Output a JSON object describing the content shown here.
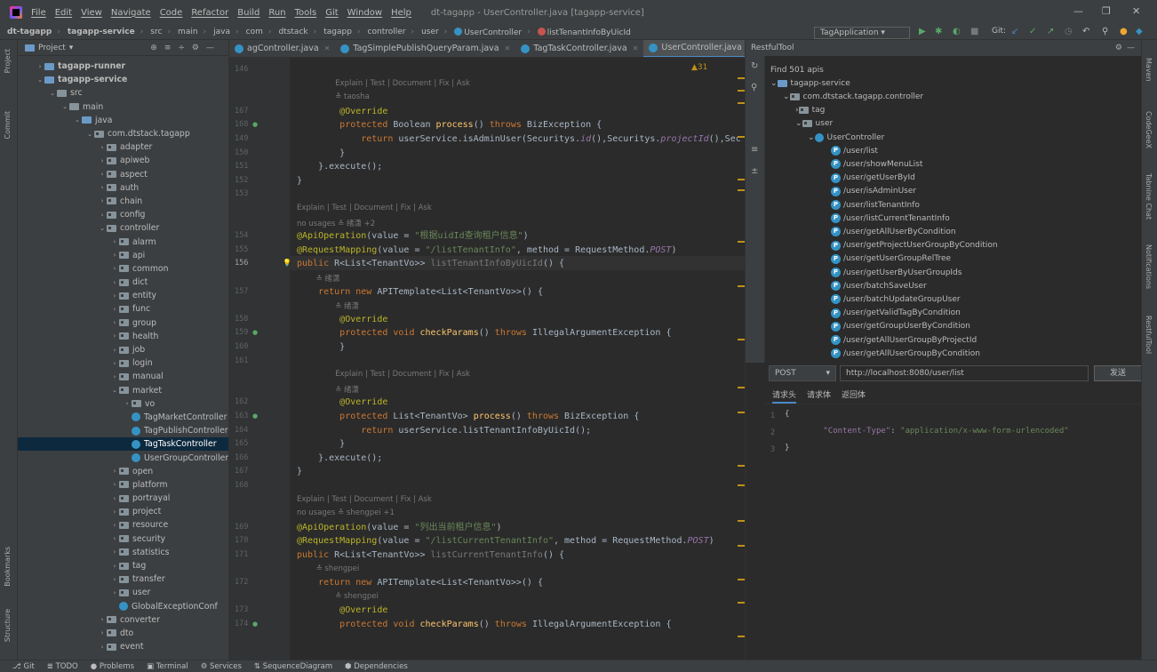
{
  "menu": {
    "items": [
      "File",
      "Edit",
      "View",
      "Navigate",
      "Code",
      "Refactor",
      "Build",
      "Run",
      "Tools",
      "Git",
      "Window",
      "Help"
    ],
    "title": "dt-tagapp - UserController.java [tagapp-service]"
  },
  "nav": {
    "crumbs": [
      "dt-tagapp",
      "tagapp-service",
      "src",
      "main",
      "java",
      "com",
      "dtstack",
      "tagapp",
      "controller",
      "user",
      "UserController",
      "listTenantInfoByUicId"
    ],
    "run_config": "TagApplication",
    "git": "Git:"
  },
  "project": {
    "title": "Project",
    "tree": [
      {
        "label": "tagapp-runner",
        "indent": 1,
        "arrow": "›",
        "icon": "fold blue",
        "bold": true
      },
      {
        "label": "tagapp-service",
        "indent": 1,
        "arrow": "⌄",
        "icon": "fold blue",
        "bold": true
      },
      {
        "label": "src",
        "indent": 2,
        "arrow": "⌄",
        "icon": "fold"
      },
      {
        "label": "main",
        "indent": 3,
        "arrow": "⌄",
        "icon": "fold"
      },
      {
        "label": "java",
        "indent": 4,
        "arrow": "⌄",
        "icon": "fold blue"
      },
      {
        "label": "com.dtstack.tagapp",
        "indent": 5,
        "arrow": "⌄",
        "icon": "fold pkg"
      },
      {
        "label": "adapter",
        "indent": 6,
        "arrow": "›",
        "icon": "fold pkg"
      },
      {
        "label": "apiweb",
        "indent": 6,
        "arrow": "›",
        "icon": "fold pkg"
      },
      {
        "label": "aspect",
        "indent": 6,
        "arrow": "›",
        "icon": "fold pkg"
      },
      {
        "label": "auth",
        "indent": 6,
        "arrow": "›",
        "icon": "fold pkg"
      },
      {
        "label": "chain",
        "indent": 6,
        "arrow": "›",
        "icon": "fold pkg"
      },
      {
        "label": "config",
        "indent": 6,
        "arrow": "›",
        "icon": "fold pkg"
      },
      {
        "label": "controller",
        "indent": 6,
        "arrow": "⌄",
        "icon": "fold pkg"
      },
      {
        "label": "alarm",
        "indent": 7,
        "arrow": "›",
        "icon": "fold pkg"
      },
      {
        "label": "api",
        "indent": 7,
        "arrow": "›",
        "icon": "fold pkg"
      },
      {
        "label": "common",
        "indent": 7,
        "arrow": "›",
        "icon": "fold pkg"
      },
      {
        "label": "dict",
        "indent": 7,
        "arrow": "›",
        "icon": "fold pkg"
      },
      {
        "label": "entity",
        "indent": 7,
        "arrow": "›",
        "icon": "fold pkg"
      },
      {
        "label": "func",
        "indent": 7,
        "arrow": "›",
        "icon": "fold pkg"
      },
      {
        "label": "group",
        "indent": 7,
        "arrow": "›",
        "icon": "fold pkg"
      },
      {
        "label": "health",
        "indent": 7,
        "arrow": "›",
        "icon": "fold pkg"
      },
      {
        "label": "job",
        "indent": 7,
        "arrow": "›",
        "icon": "fold pkg"
      },
      {
        "label": "login",
        "indent": 7,
        "arrow": "›",
        "icon": "fold pkg"
      },
      {
        "label": "manual",
        "indent": 7,
        "arrow": "›",
        "icon": "fold pkg"
      },
      {
        "label": "market",
        "indent": 7,
        "arrow": "⌄",
        "icon": "fold pkg"
      },
      {
        "label": "vo",
        "indent": 8,
        "arrow": "›",
        "icon": "fold pkg"
      },
      {
        "label": "TagMarketController",
        "indent": 8,
        "arrow": "",
        "icon": "cls"
      },
      {
        "label": "TagPublishController",
        "indent": 8,
        "arrow": "",
        "icon": "cls"
      },
      {
        "label": "TagTaskController",
        "indent": 8,
        "arrow": "",
        "icon": "cls",
        "sel": true
      },
      {
        "label": "UserGroupController",
        "indent": 8,
        "arrow": "",
        "icon": "cls"
      },
      {
        "label": "open",
        "indent": 7,
        "arrow": "›",
        "icon": "fold pkg"
      },
      {
        "label": "platform",
        "indent": 7,
        "arrow": "›",
        "icon": "fold pkg"
      },
      {
        "label": "portrayal",
        "indent": 7,
        "arrow": "›",
        "icon": "fold pkg"
      },
      {
        "label": "project",
        "indent": 7,
        "arrow": "›",
        "icon": "fold pkg"
      },
      {
        "label": "resource",
        "indent": 7,
        "arrow": "›",
        "icon": "fold pkg"
      },
      {
        "label": "security",
        "indent": 7,
        "arrow": "›",
        "icon": "fold pkg"
      },
      {
        "label": "statistics",
        "indent": 7,
        "arrow": "›",
        "icon": "fold pkg"
      },
      {
        "label": "tag",
        "indent": 7,
        "arrow": "›",
        "icon": "fold pkg"
      },
      {
        "label": "transfer",
        "indent": 7,
        "arrow": "›",
        "icon": "fold pkg"
      },
      {
        "label": "user",
        "indent": 7,
        "arrow": "›",
        "icon": "fold pkg"
      },
      {
        "label": "GlobalExceptionConf",
        "indent": 7,
        "arrow": "",
        "icon": "cls"
      },
      {
        "label": "converter",
        "indent": 6,
        "arrow": "›",
        "icon": "fold pkg"
      },
      {
        "label": "dto",
        "indent": 6,
        "arrow": "›",
        "icon": "fold pkg"
      },
      {
        "label": "event",
        "indent": 6,
        "arrow": "›",
        "icon": "fold pkg"
      }
    ]
  },
  "tabs": [
    {
      "label": "agController.java",
      "active": false
    },
    {
      "label": "TagSimplePublishQueryParam.java",
      "active": false
    },
    {
      "label": "TagTaskController.java",
      "active": false
    },
    {
      "label": "UserController.java",
      "active": true
    }
  ],
  "editor": {
    "warnings": "▲31",
    "lines": [
      {
        "n": "146",
        "t": "<span class='gr'> </span>"
      },
      {
        "hint": "Explain | Test | Document | Fix | Ask",
        "ind": 48
      },
      {
        "hint": "≛ taosha",
        "ind": 48
      },
      {
        "n": "167",
        "t": "        <span class='an'>@Override</span>"
      },
      {
        "n": "168",
        "t": "        <span class='kw'>protected</span> Boolean <span class='mt'>process</span>() <span class='kw'>throws</span> BizException {",
        "gi": true
      },
      {
        "n": "149",
        "t": "            <span class='kw'>return</span> userService.isAdminUser(Securitys.<span class='it'>id</span>(),Securitys.<span class='it'>projectId</span>(),Sec"
      },
      {
        "n": "150",
        "t": "        }"
      },
      {
        "n": "151",
        "t": "    }.execute();"
      },
      {
        "n": "152",
        "t": "}"
      },
      {
        "n": "153",
        "t": ""
      },
      {
        "hint": "Explain | Test | Document | Fix | Ask",
        "ind": 0
      },
      {
        "hint": "no usages   ≛ 绪潇 +2",
        "ind": 0
      },
      {
        "n": "154",
        "t": "<span class='an'>@ApiOperation</span>(value = <span class='st'>\"根据uidId查询租户信息\"</span>)"
      },
      {
        "n": "155",
        "t": "<span class='an'>@RequestMapping</span>(value = <span class='st'>\"/listTenantInfo\"</span>, method = RequestMethod.<span class='it'>POST</span>)"
      },
      {
        "n": "156",
        "t": "<span class='kw'>public</span> R&lt;List&lt;TenantVo&gt;&gt; <span class='gr'>listTenantInfoByUicId</span>() {",
        "cur": true
      },
      {
        "hint": "≛ 绪潇",
        "ind": 24
      },
      {
        "n": "157",
        "t": "    <span class='kw'>return new</span> APITemplate&lt;List&lt;TenantVo&gt;&gt;() {"
      },
      {
        "hint": "≛ 绪潇",
        "ind": 48
      },
      {
        "n": "158",
        "t": "        <span class='an'>@Override</span>"
      },
      {
        "n": "159",
        "t": "        <span class='kw'>protected void</span> <span class='mt'>checkParams</span>() <span class='kw'>throws</span> IllegalArgumentException {",
        "gi": true
      },
      {
        "n": "160",
        "t": "        }"
      },
      {
        "n": "161",
        "t": ""
      },
      {
        "hint": "Explain | Test | Document | Fix | Ask",
        "ind": 48
      },
      {
        "hint": "≛ 绪潇",
        "ind": 48
      },
      {
        "n": "162",
        "t": "        <span class='an'>@Override</span>"
      },
      {
        "n": "163",
        "t": "        <span class='kw'>protected</span> List&lt;TenantVo&gt; <span class='mt'>process</span>() <span class='kw'>throws</span> BizException {",
        "gi": true
      },
      {
        "n": "164",
        "t": "            <span class='kw'>return</span> userService.listTenantInfoByUicId();"
      },
      {
        "n": "165",
        "t": "        }"
      },
      {
        "n": "166",
        "t": "    }.execute();"
      },
      {
        "n": "167",
        "t": "}"
      },
      {
        "n": "168",
        "t": ""
      },
      {
        "hint": "Explain | Test | Document | Fix | Ask",
        "ind": 0
      },
      {
        "hint": "no usages   ≛ shengpei +1",
        "ind": 0
      },
      {
        "n": "169",
        "t": "<span class='an'>@ApiOperation</span>(value = <span class='st'>\"列出当前租户信息\"</span>)"
      },
      {
        "n": "170",
        "t": "<span class='an'>@RequestMapping</span>(value = <span class='st'>\"/listCurrentTenantInfo\"</span>, method = RequestMethod.<span class='it'>POST</span>)"
      },
      {
        "n": "171",
        "t": "<span class='kw'>public</span> R&lt;List&lt;TenantVo&gt;&gt; <span class='gr'>listCurrentTenantInfo</span>() {"
      },
      {
        "hint": "≛ shengpei",
        "ind": 24
      },
      {
        "n": "172",
        "t": "    <span class='kw'>return new</span> APITemplate&lt;List&lt;TenantVo&gt;&gt;() {"
      },
      {
        "hint": "≛ shengpei",
        "ind": 48
      },
      {
        "n": "173",
        "t": "        <span class='an'>@Override</span>"
      },
      {
        "n": "174",
        "t": "        <span class='kw'>protected void</span> <span class='mt'>checkParams</span>() <span class='kw'>throws</span> IllegalArgumentException {",
        "gi": true
      }
    ]
  },
  "restful": {
    "title": "RestfulTool",
    "find": "Find 501 apis",
    "module": "tagapp-service",
    "package": "com.dtstack.tagapp.controller",
    "nodes": [
      "tag",
      "user"
    ],
    "controller": "UserController",
    "apis": [
      "/user/list",
      "/user/showMenuList",
      "/user/getUserById",
      "/user/isAdminUser",
      "/user/listTenantInfo",
      "/user/listCurrentTenantInfo",
      "/user/getAllUserByCondition",
      "/user/getProjectUserGroupByCondition",
      "/user/getUserGroupRelTree",
      "/user/getUserByUserGroupIds",
      "/user/batchSaveUser",
      "/user/batchUpdateGroupUser",
      "/user/getValidTagByCondition",
      "/user/getGroupUserByCondition",
      "/user/getAllUserGroupByProjectId",
      "/user/getAllUserGroupByCondition"
    ],
    "method": "POST",
    "url": "http://localhost:8080/user/list",
    "send": "发送",
    "req_tabs": [
      "请求头",
      "请求体",
      "返回体"
    ],
    "body_lines": [
      {
        "n": "1",
        "t": "{"
      },
      {
        "n": "2",
        "k": "\"Content-Type\"",
        "v": "\"application/x-www-form-urlencoded\""
      },
      {
        "n": "3",
        "t": "}"
      }
    ]
  },
  "left_tabs": [
    "Project",
    "Commit",
    "Bookmarks",
    "Structure"
  ],
  "right_tabs": [
    "Maven",
    "CodeGeeX",
    "Tabnine Chat",
    "Notifications",
    "RestfulTool"
  ],
  "bottom": [
    "Git",
    "TODO",
    "Problems",
    "Terminal",
    "Services",
    "SequenceDiagram",
    "Dependencies"
  ],
  "colors": {
    "accent": "#3592c4",
    "selection": "#0d293e",
    "warning": "#be9117"
  }
}
